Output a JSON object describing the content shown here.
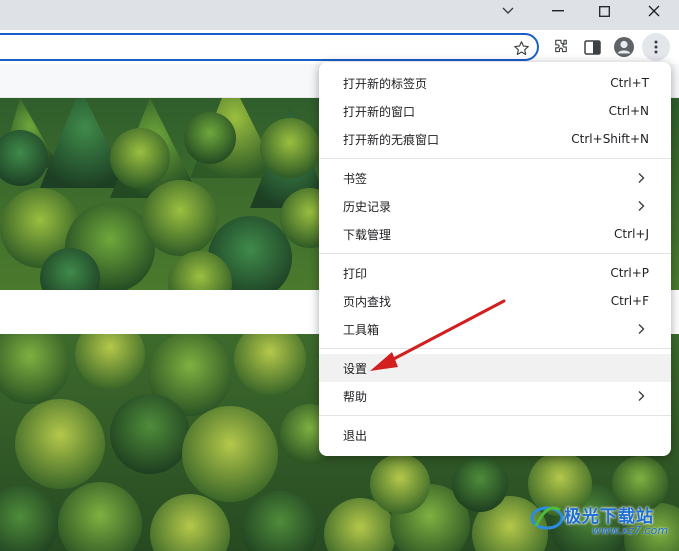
{
  "window": {
    "controls": [
      "chevron-down",
      "minimize",
      "maximize",
      "close"
    ]
  },
  "toolbar": {
    "icons": [
      "star-icon",
      "extensions-icon",
      "side-panel-icon",
      "profile-icon",
      "more-menu-icon"
    ]
  },
  "menu": {
    "items": [
      {
        "label": "打开新的标签页",
        "shortcut": "Ctrl+T"
      },
      {
        "label": "打开新的窗口",
        "shortcut": "Ctrl+N"
      },
      {
        "label": "打开新的无痕窗口",
        "shortcut": "Ctrl+Shift+N"
      },
      {
        "label": "书签",
        "submenu": true
      },
      {
        "label": "历史记录",
        "submenu": true
      },
      {
        "label": "下载管理",
        "shortcut": "Ctrl+J"
      },
      {
        "label": "打印",
        "shortcut": "Ctrl+P"
      },
      {
        "label": "页内查找",
        "shortcut": "Ctrl+F"
      },
      {
        "label": "工具箱",
        "submenu": true
      },
      {
        "label": "设置",
        "highlighted": true
      },
      {
        "label": "帮助",
        "submenu": true
      },
      {
        "label": "退出"
      }
    ]
  },
  "annotation": {
    "arrow_color": "#d21f1f"
  },
  "watermark": {
    "text": "极光下载站",
    "url": "www.xz7.com"
  },
  "colors": {
    "accent": "#1a5fc8",
    "forest": "#3d6a2c"
  }
}
